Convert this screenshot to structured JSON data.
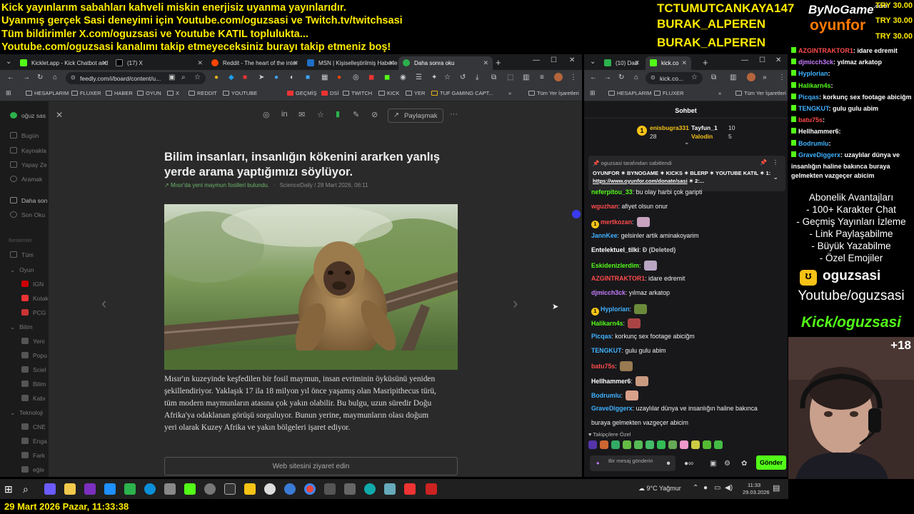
{
  "ticker": {
    "lines": [
      "Kick yayınlarım sabahları kahveli miskin enerjisiz uyanma yayınlarıdır.",
      "Uyanmış gerçek Sasi deneyimi için Youtube.com/oguzsasi ve Twitch.tv/twitchsasi",
      "Tüm bildirimler X.com/oguzsasi ve Youtube KATIL topluluktа...",
      "Youtube.com/oguzsasi kanalımı takip etmeyeceksiniz burayı takip etmeniz boş!"
    ]
  },
  "subs": [
    "TCTUMUTCANKAYA147",
    "BURAK_ALPEREN",
    "BURAK_ALPEREN"
  ],
  "logo": {
    "top": "ByNoGame",
    "com": ".com",
    "bottom": "oyunfor"
  },
  "tries": [
    "TRY 30.00",
    "TRY 30.00",
    "TRY 30.00"
  ],
  "browser_left": {
    "tabs": [
      {
        "label": "Kicklet.app - Kick Chatbot and",
        "color": "#53fc18"
      },
      {
        "label": "(17) X",
        "color": "#000"
      },
      {
        "label": "Reddit - The heart of the inter",
        "color": "#ff4500"
      },
      {
        "label": "MSN | Kişiselleştirilmiş Haberle",
        "color": "#1f6fc5"
      },
      {
        "label": "Daha sonra oku",
        "color": "#2bb24c"
      }
    ],
    "url": "feedly.com/i/board/content/u...",
    "bookmarks": [
      "HESAPLARIM",
      "FLUXER",
      "HABER",
      "OYUN",
      "X",
      "REDDIT",
      "YOUTUBE",
      "GEÇMİŞ",
      "DSİ",
      "TWITCH",
      "KICK",
      "YER",
      "TUF GAMING CAPT...",
      "Tüm Yer İşaretleri"
    ]
  },
  "feedly": {
    "sidebar": {
      "top": "oğuz sas",
      "items": [
        "Bugün",
        "Kaynakla",
        "Yapay Ze",
        "Aramak",
        "Daha son",
        "Son Oku",
        "Beslemler",
        "Tüm",
        "Oyun",
        "IGN",
        "Kotak",
        "PCG",
        "Bilim",
        "Yeni",
        "Popu",
        "Sciel",
        "Bilim",
        "Kabı",
        "Teknoloji",
        "CNE",
        "Enga",
        "Fark",
        "eğle"
      ]
    },
    "share_label": "Paylaşmak",
    "title": "Bilim insanları, insanlığın kökenini ararken yanlış yerde arama yaptığımızı söylüyor.",
    "meta_feed": "Mısır'da yeni maymun fosilleri bulundu.",
    "meta_source": "ScienceDaily / 28 Mart 2026, 06:11",
    "body": "Mısır'ın kuzeyinde keşfedilen bir fosil maymun, insan evriminin öyküsünü yeniden şekillendiriyor. Yaklaşık 17 ila 18 milyon yıl önce yaşamış olan Masripithecus türü, tüm modern maymunların atasına çok yakın olabilir. Bu bulgu, uzun süredir Doğu Afrika'ya odaklanan görüşü sorguluyor. Bunun yerine, maymunların olası doğum yeri olarak Kuzey Afrika ve yakın bölgeleri işaret ediyor.",
    "visit_label": "Web sitesini ziyaret edin"
  },
  "browser_right": {
    "tabs": [
      "(10) Dad",
      "kick.co"
    ],
    "url": "kick.co...",
    "bookmarks": [
      "HESAPLARIM",
      "FLUXER",
      "Tüm Yer İşaretleri"
    ],
    "chat_title": "Sohbet",
    "leaders": [
      {
        "name": "enisbugra331",
        "count": "28"
      },
      {
        "name": "Tayfun_1",
        "count": "10"
      },
      {
        "name": "Valodin",
        "count": "5"
      }
    ],
    "pinned_by": "oguzsasi tarafından sabitlendi",
    "pinned_text": "OYUNFOR ✶ BYNOGAME ✶ KICKS ✶ BLERP ✶ YOUTUBE KATIL ✶ 1:",
    "pinned_link": "https://www.oyunfor.com/donate/sasi",
    "pinned_tail": "✶ 2:...",
    "messages": [
      {
        "user": "neferpitou_33",
        "color": "#53fc18",
        "text": "bu olay harbi çok garipti"
      },
      {
        "user": "wguzhan",
        "color": "#ff4b4b",
        "text": "afiyet olsun onur"
      },
      {
        "user": "mertkozan",
        "color": "#ff4b4b",
        "text": ""
      },
      {
        "user": "JannKee",
        "color": "#3fb2ff",
        "text": "gelsinler artik aminakoyarim"
      },
      {
        "user": "Entelektuel_tilki",
        "color": "#fff",
        "text": "Ð (Deleted)"
      },
      {
        "user": "Eskidenizlerdim",
        "color": "#53fc18",
        "text": ""
      },
      {
        "user": "AZGINTRAKTOR1",
        "color": "#ff4b4b",
        "text": "idare edremit"
      },
      {
        "user": "djmicch3ck",
        "color": "#c77dff",
        "text": "yılmaz arkatop"
      },
      {
        "user": "Hyplorian",
        "color": "#3fb2ff",
        "text": ""
      },
      {
        "user": "Halikarn4s",
        "color": "#53fc18",
        "text": ""
      },
      {
        "user": "Picqas",
        "color": "#3fb2ff",
        "text": "korkunç sex footage abiciğm"
      },
      {
        "user": "TENGKUT",
        "color": "#3fb2ff",
        "text": "gulu gulu abim"
      },
      {
        "user": "batu75s",
        "color": "#ff4b4b",
        "text": ""
      },
      {
        "user": "Hellhammer6",
        "color": "#fff",
        "text": ""
      },
      {
        "user": "Bodrumlu",
        "color": "#3fb2ff",
        "text": ""
      },
      {
        "user": "GraveDiggerx",
        "color": "#3fb2ff",
        "text": "uzaylılar dünya ve insanlığın haline bakınca"
      },
      {
        "user": "",
        "color": "#fff",
        "text": "buraya gelmekten vazgeçer abicim"
      }
    ],
    "followers_only": "Takipçilere Özel",
    "input_placeholder": "Bir mesaj gönderin",
    "send_label": "Gönder"
  },
  "overlay_chat": [
    {
      "user": "AZGINTRAKTOR1",
      "color": "#ff4b4b",
      "text": ": idare edremit"
    },
    {
      "user": "djmicch3ck",
      "color": "#c77dff",
      "text": ": yılmaz arkatop"
    },
    {
      "user": "Hyplorian",
      "color": "#3fb2ff",
      "text": ":"
    },
    {
      "user": "Halikarn4s",
      "color": "#53fc18",
      "text": ":"
    },
    {
      "user": "Picqas",
      "color": "#3fb2ff",
      "text": ": korkunç sex footage abiciğm"
    },
    {
      "user": "TENGKUT",
      "color": "#3fb2ff",
      "text": ": gulu gulu abim"
    },
    {
      "user": "batu75s",
      "color": "#ff4b4b",
      "text": ":"
    },
    {
      "user": "Hellhammer6",
      "color": "#fff",
      "text": ":"
    },
    {
      "user": "Bodrumlu",
      "color": "#3fb2ff",
      "text": ":"
    },
    {
      "user": "GraveDiggerx",
      "color": "#3fb2ff",
      "text": ": uzaylılar dünya ve"
    }
  ],
  "overlay_chat_cont": [
    "insanlığın haline bakınca buraya",
    "gelmekten vazgeçer abicim"
  ],
  "perks": [
    "Abonelik Avantajları",
    "- 100+ Karakter Chat",
    "- Geçmiş Yayınları İzleme",
    "- Link Paylaşabilme",
    "- Büyük Yazabilme",
    "- Özel Emojiler"
  ],
  "channel": {
    "name": "oguzsasi",
    "youtube": "Youtube/oguzsasi",
    "kick": "Kick/oguzsasi",
    "age": "+18"
  },
  "taskbar": {
    "weather": "9°C  Yağmur",
    "time": "11:33",
    "date": "29.03.2026"
  },
  "status_text": "29 Mart 2026 Pazar, 11:33:38"
}
